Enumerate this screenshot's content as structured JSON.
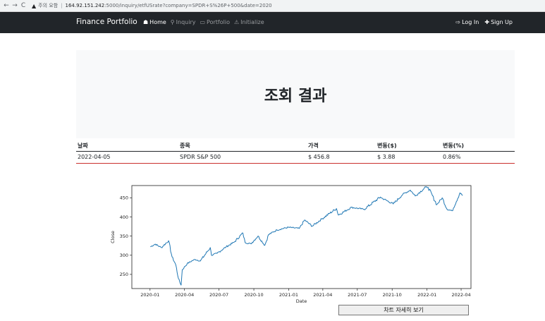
{
  "browser": {
    "back_glyph": "←",
    "forward_glyph": "→",
    "reload_glyph": "C",
    "warning_text": "주의 요함",
    "url_host": "164.92.151.242",
    "url_rest": ":5000/inquiry/etfUSrate?company=SPDR+S%26P+500&date=2020"
  },
  "navbar": {
    "brand": "Finance Portfolio",
    "links": [
      {
        "label": "Home",
        "icon": "home-icon",
        "glyph": "☗"
      },
      {
        "label": "Inquiry",
        "icon": "search-icon",
        "glyph": "⚲"
      },
      {
        "label": "Portfolio",
        "icon": "book-icon",
        "glyph": "▭"
      },
      {
        "label": "Initialize",
        "icon": "warning-icon",
        "glyph": "⚠"
      }
    ],
    "right": [
      {
        "label": "Log In",
        "icon": "login-icon",
        "glyph": "⇨"
      },
      {
        "label": "Sign Up",
        "icon": "user-add-icon",
        "glyph": "✚"
      }
    ]
  },
  "jumbotron": {
    "title": "조회 결과"
  },
  "table": {
    "headers": [
      "날짜",
      "종목",
      "가격",
      "변동($)",
      "변동(%)"
    ],
    "row": [
      "2022-04-05",
      "SPDR S&P 500",
      "$ 456.8",
      "$ 3.88",
      "0.86%"
    ]
  },
  "chart_data": {
    "type": "line",
    "xlabel": "Date",
    "ylabel": "Close",
    "x_ticks": [
      "2020-01",
      "2020-04",
      "2020-07",
      "2020-10",
      "2021-01",
      "2021-04",
      "2021-07",
      "2021-10",
      "2022-01",
      "2022-04"
    ],
    "y_ticks": [
      250,
      300,
      350,
      400,
      450
    ],
    "ylim": [
      213,
      482
    ],
    "xlim": [
      "2019-11-14",
      "2022-04-27"
    ],
    "grid": false,
    "color": "#1f77b4",
    "series": [
      {
        "x": [
          "2020-01-02",
          "2020-01-15",
          "2020-01-31",
          "2020-02-19",
          "2020-02-28",
          "2020-03-09",
          "2020-03-16",
          "2020-03-23",
          "2020-03-26",
          "2020-04-08",
          "2020-04-20",
          "2020-04-29",
          "2020-05-13",
          "2020-06-08",
          "2020-06-11",
          "2020-06-26",
          "2020-07-20",
          "2020-08-10",
          "2020-09-02",
          "2020-09-08",
          "2020-09-23",
          "2020-10-12",
          "2020-10-30",
          "2020-11-09",
          "2020-12-01",
          "2020-12-31",
          "2021-01-29",
          "2021-02-12",
          "2021-03-04",
          "2021-03-31",
          "2021-05-07",
          "2021-05-12",
          "2021-06-15",
          "2021-07-19",
          "2021-08-31",
          "2021-09-02",
          "2021-10-04",
          "2021-10-29",
          "2021-11-18",
          "2021-12-01",
          "2021-12-29",
          "2022-01-04",
          "2022-01-27",
          "2022-02-10",
          "2022-02-23",
          "2022-03-08",
          "2022-03-29",
          "2022-04-05"
        ],
        "values": [
          322,
          329,
          320,
          338,
          296,
          275,
          239,
          222,
          262,
          278,
          285,
          289,
          285,
          320,
          300,
          305,
          322,
          334,
          358,
          333,
          330,
          350,
          326,
          354,
          366,
          373,
          370,
          392,
          376,
          396,
          422,
          405,
          425,
          420,
          452,
          450,
          434,
          459,
          470,
          455,
          478,
          477,
          432,
          450,
          420,
          416,
          463,
          456
        ]
      }
    ]
  },
  "detail_button": {
    "label": "차트 자세히 보기"
  }
}
